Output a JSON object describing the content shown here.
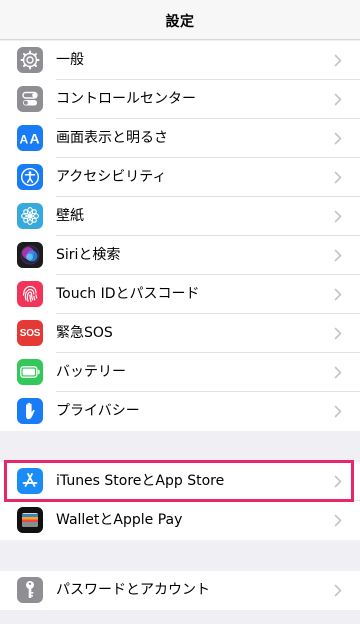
{
  "header": {
    "title": "設定"
  },
  "groups": [
    {
      "items": [
        {
          "label": "一般",
          "icon": "gear-icon",
          "color": "#8e8e93"
        },
        {
          "label": "コントロールセンター",
          "icon": "toggles-icon",
          "color": "#8e8e93"
        },
        {
          "label": "画面表示と明るさ",
          "icon": "text-size-icon",
          "color": "#1a7cf5"
        },
        {
          "label": "アクセシビリティ",
          "icon": "accessibility-icon",
          "color": "#1a7cf5"
        },
        {
          "label": "壁紙",
          "icon": "flower-icon",
          "color": "#36aadc"
        },
        {
          "label": "Siriと検索",
          "icon": "siri-icon",
          "color": "#1c1c1e"
        },
        {
          "label": "Touch IDとパスコード",
          "icon": "fingerprint-icon",
          "color": "#f2335a"
        },
        {
          "label": "緊急SOS",
          "icon": "sos-icon",
          "color": "#e53935",
          "icon_text": "SOS"
        },
        {
          "label": "バッテリー",
          "icon": "battery-icon",
          "color": "#34c759"
        },
        {
          "label": "プライバシー",
          "icon": "hand-icon",
          "color": "#1a7cf5"
        }
      ]
    },
    {
      "items": [
        {
          "label": "iTunes StoreとApp Store",
          "icon": "app-store-icon",
          "color": "#1a8cf7"
        },
        {
          "label": "WalletとApple Pay",
          "icon": "wallet-icon",
          "color": "#111111"
        }
      ]
    },
    {
      "items": [
        {
          "label": "パスワードとアカウント",
          "icon": "key-icon",
          "color": "#8e8e93"
        }
      ]
    }
  ],
  "highlight_color": "#e8266a"
}
